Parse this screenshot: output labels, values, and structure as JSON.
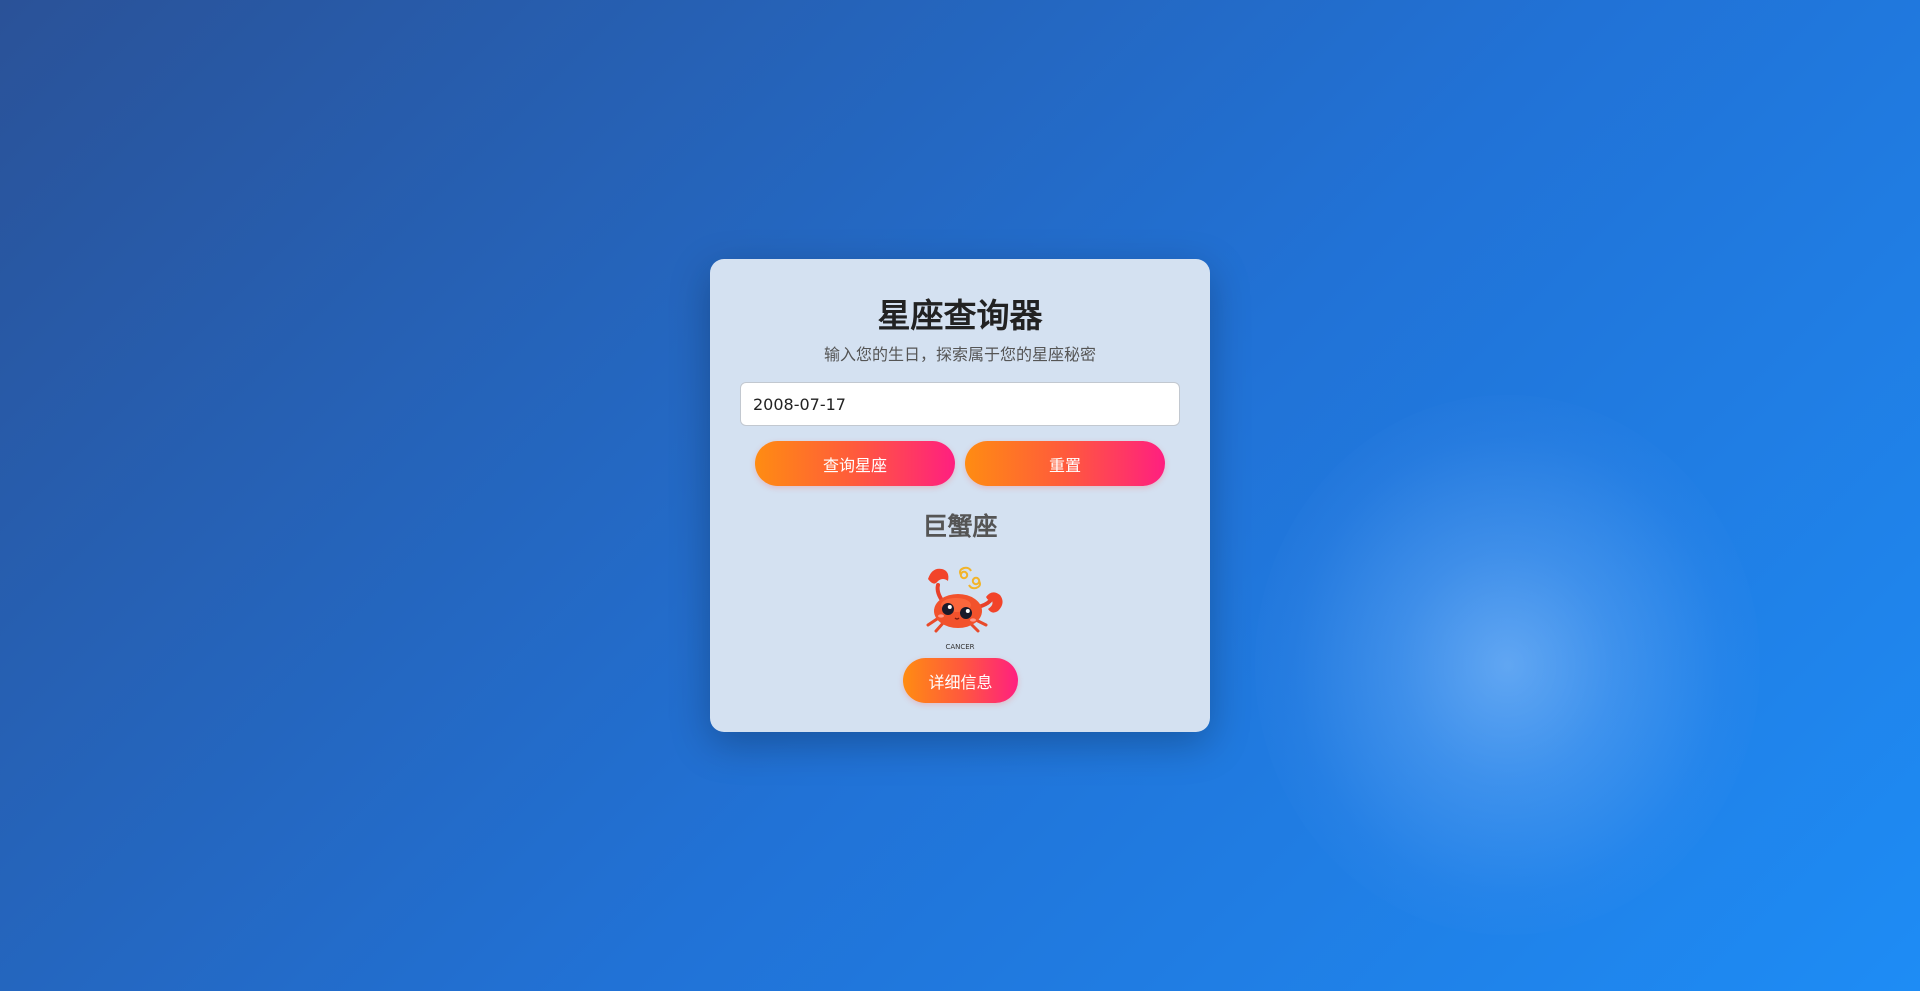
{
  "app": {
    "title": "星座查询器",
    "subtitle": "输入您的生日，探索属于您的星座秘密"
  },
  "form": {
    "date_value": "2008-07-17"
  },
  "buttons": {
    "query_label": "查询星座",
    "reset_label": "重置",
    "detail_label": "详细信息"
  },
  "result": {
    "sign_name": "巨蟹座",
    "image_icon": "crab-icon",
    "image_caption": "CANCER"
  },
  "colors": {
    "background_start": "#2a5298",
    "background_end": "#1e8cf5",
    "card": "#d4e1f1",
    "button_gradient_start": "#ff8c12",
    "button_gradient_end": "#ff1f80"
  }
}
